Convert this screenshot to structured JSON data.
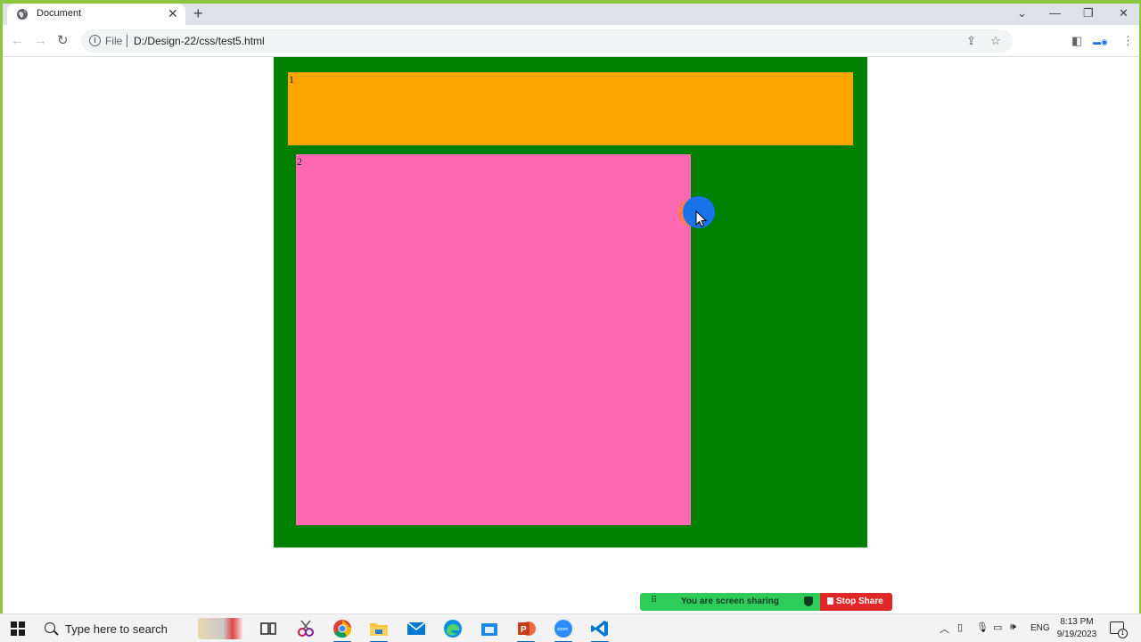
{
  "browser": {
    "tab_title": "Document",
    "tab_close": "✕",
    "new_tab": "+",
    "address": {
      "scheme_label": "File",
      "url": "D:/Design-22/css/test5.html"
    },
    "window_controls": {
      "chevron": "⌄",
      "minimize": "—",
      "maximize": "❐",
      "close": "✕"
    }
  },
  "page": {
    "container_color": "#008000",
    "boxes": [
      {
        "label": "1",
        "color": "#ffa500"
      },
      {
        "label": "2",
        "color": "#ff69b4"
      }
    ]
  },
  "zoom_share_bar": {
    "status_text": "You are screen sharing",
    "stop_label": "Stop Share",
    "status_color": "#2fcc5c",
    "stop_color": "#e02828"
  },
  "taskbar": {
    "search_placeholder": "Type here to search",
    "language": "ENG",
    "time": "8:13 PM",
    "date": "9/19/2023",
    "notification_count": "1",
    "apps": [
      "notes-app-icon",
      "task-view-icon",
      "snipping-tool-icon",
      "chrome-icon",
      "file-explorer-icon",
      "mail-icon",
      "edge-icon",
      "store-icon",
      "powerpoint-icon",
      "zoom-icon",
      "vscode-icon"
    ]
  }
}
